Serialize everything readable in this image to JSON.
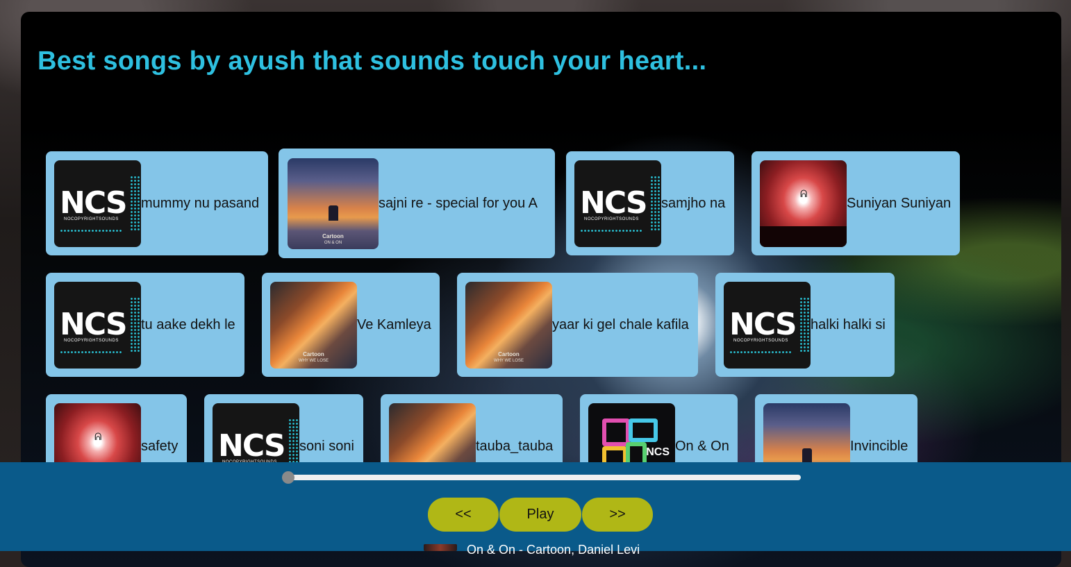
{
  "header": {
    "title": "Best songs by ayush that sounds touch your heart..."
  },
  "songs": [
    {
      "name": "mummy nu pasand",
      "cover": "ncs-logo-cover"
    },
    {
      "name": "sajni re - special for you A",
      "cover": "cartoon-on-on-cover"
    },
    {
      "name": "samjho na",
      "cover": "ncs-logo-cover"
    },
    {
      "name": "Suniyan Suniyan",
      "cover": "red-figure-cover"
    },
    {
      "name": "tu aake dekh le",
      "cover": "ncs-logo-cover"
    },
    {
      "name": "Ve Kamleya",
      "cover": "cartoon-why-we-lose-cover"
    },
    {
      "name": "yaar ki gel chale kafila",
      "cover": "cartoon-why-we-lose-cover"
    },
    {
      "name": "halki halki si",
      "cover": "ncs-logo-cover"
    },
    {
      "name": "safety",
      "cover": "red-figure-cover"
    },
    {
      "name": "soni soni",
      "cover": "ncs-logo-cover"
    },
    {
      "name": "tauba_tauba",
      "cover": "cartoon-why-we-lose-cover"
    },
    {
      "name": "On & On",
      "cover": "ncs-maze-cover"
    },
    {
      "name": "Invincible",
      "cover": "cartoon-on-on-cover"
    }
  ],
  "covers": {
    "ncs_logo": "NCS",
    "ncs_sub": "NOCOPYRIGHTSOUNDS",
    "cartoon_label": "Cartoon",
    "on_on": "ON & ON",
    "why_we_lose": "WHY WE LOSE",
    "maze_ncs": "NCS"
  },
  "player": {
    "progress": 0,
    "prev_label": "<<",
    "play_label": "Play",
    "next_label": ">>",
    "now_playing": "On & On - Cartoon, Daniel Levi"
  },
  "colors": {
    "title": "#2ec0e0",
    "card": "#84c5e8",
    "player_bar": "#0a5a8a",
    "button": "#b0b716"
  }
}
